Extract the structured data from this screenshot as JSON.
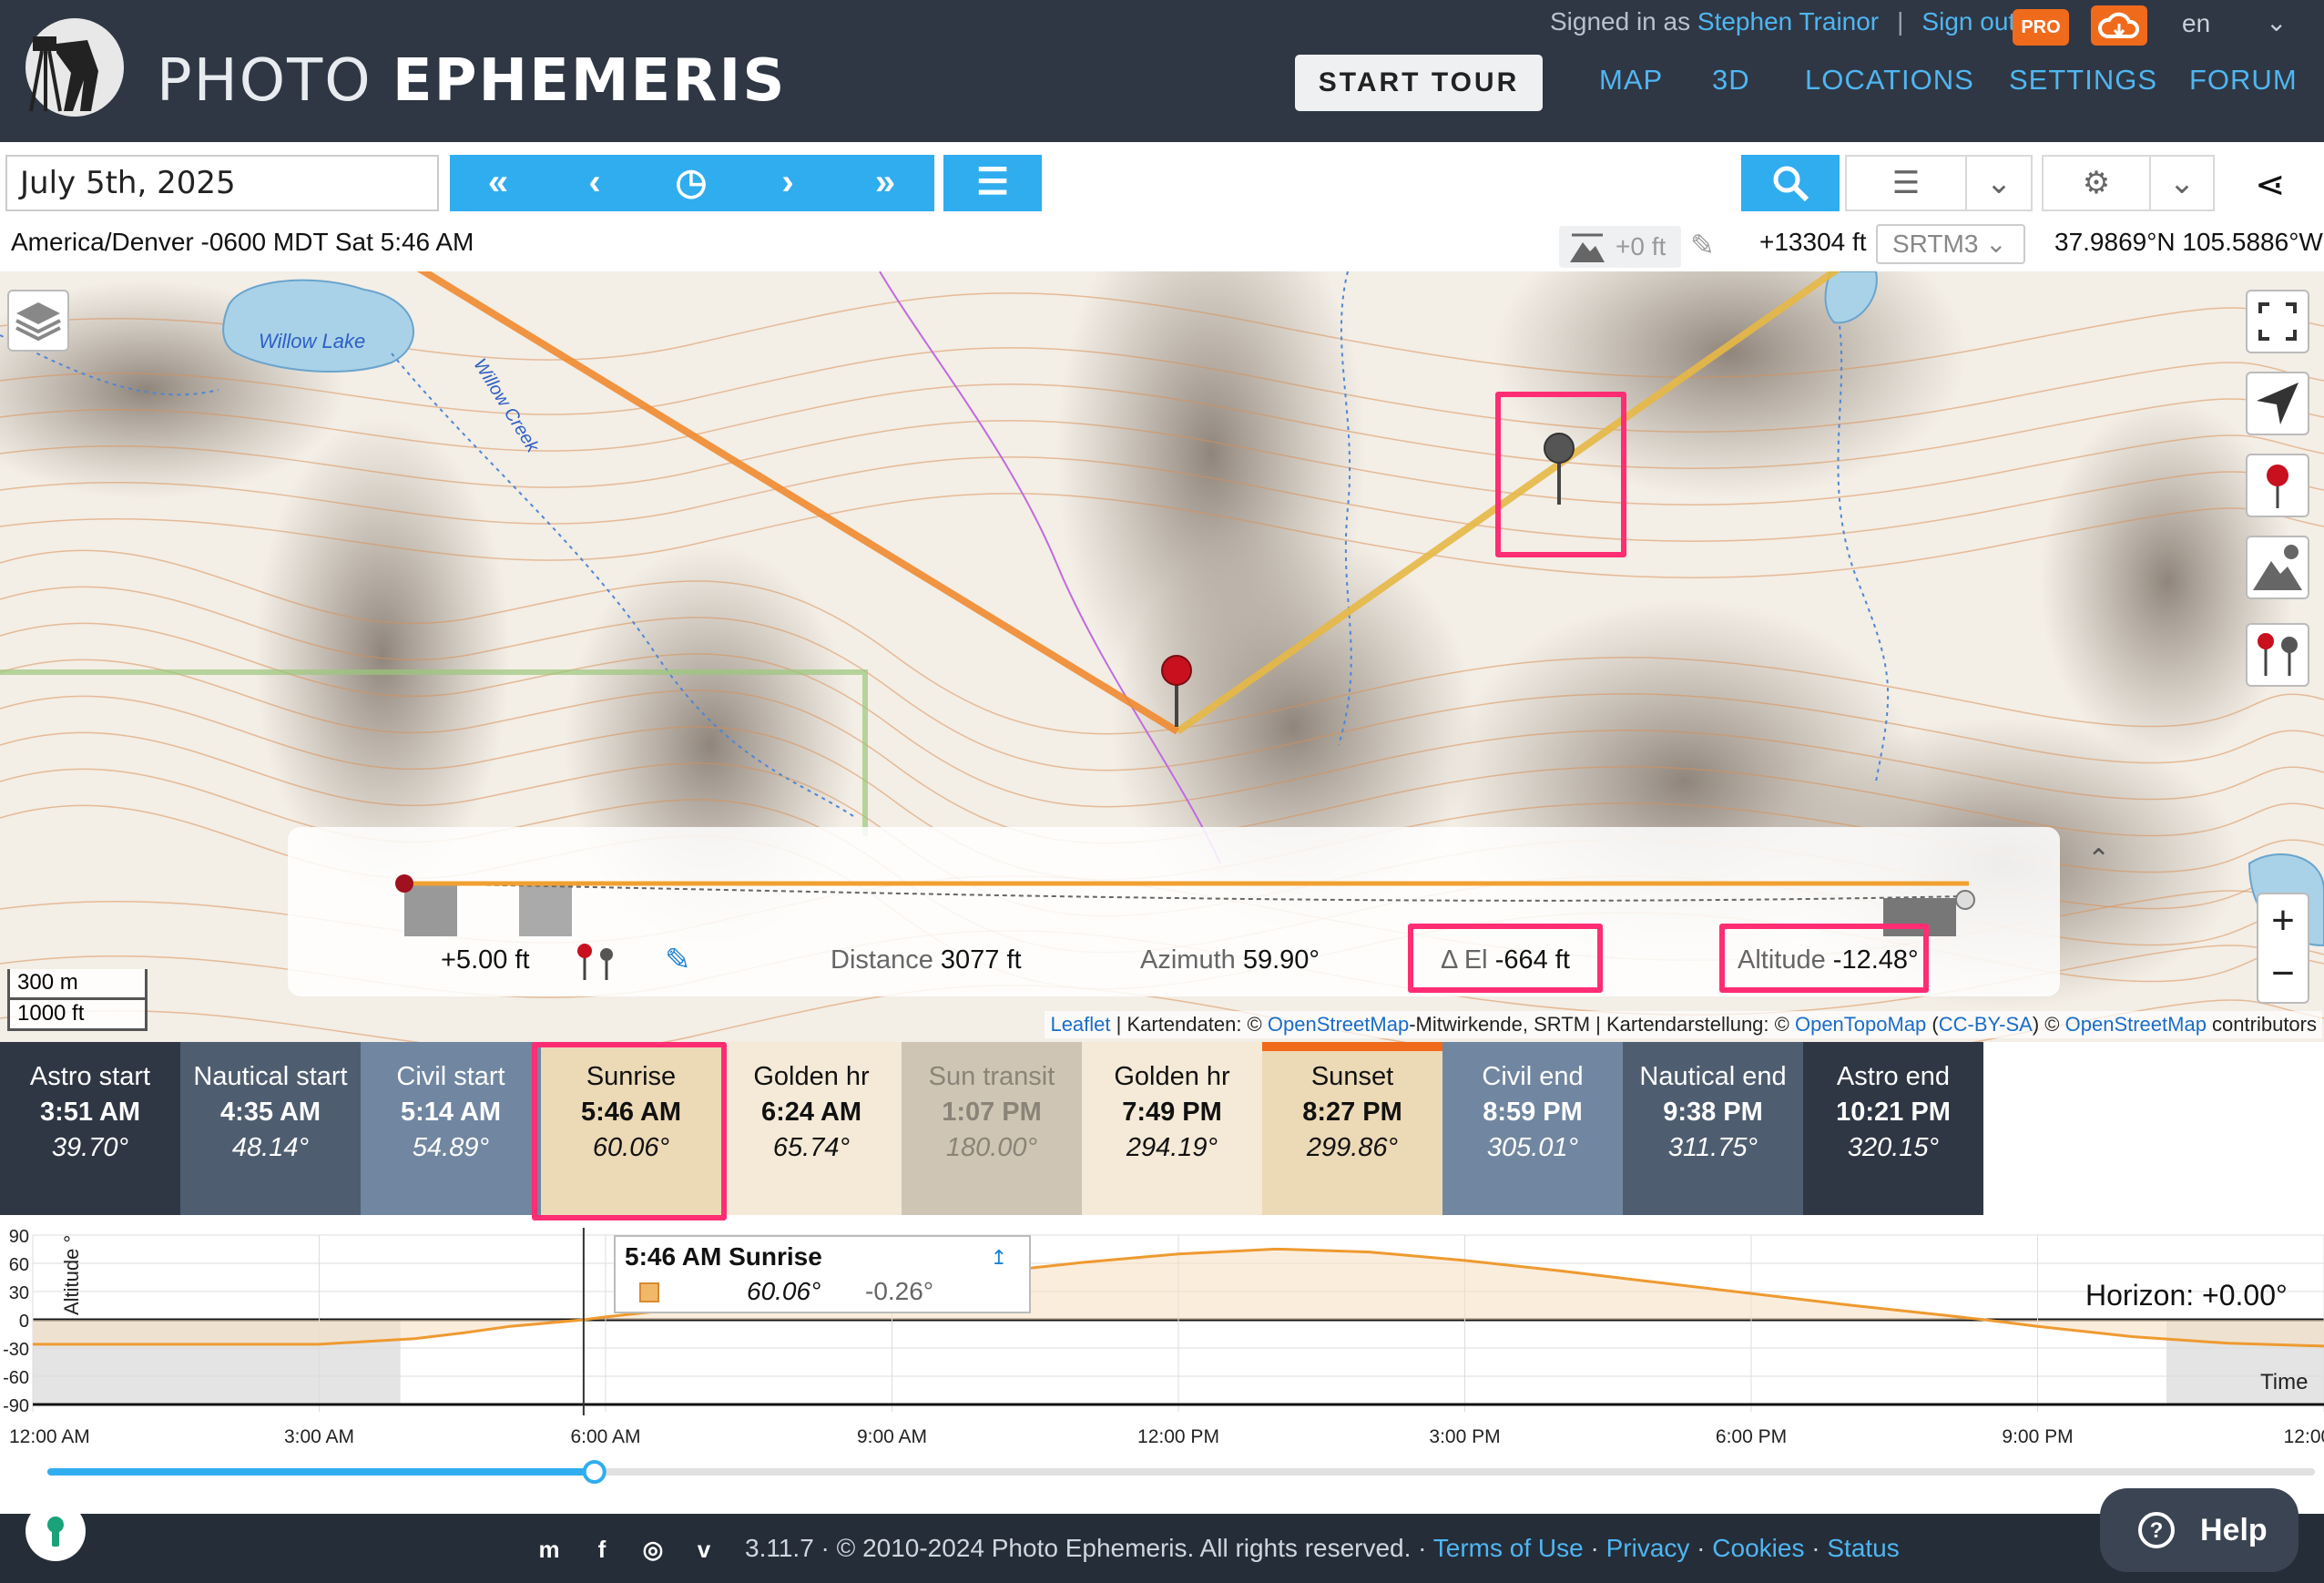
{
  "header": {
    "brand_light": "PHOTO",
    "brand_bold": "EPHEMERIS",
    "signed_in_prefix": "Signed in as",
    "user_name": "Stephen Trainor",
    "sign_out": "Sign out",
    "pro_badge": "PRO",
    "language": "en",
    "start_tour": "START TOUR",
    "nav": [
      "MAP",
      "3D",
      "LOCATIONS",
      "SETTINGS",
      "FORUM"
    ],
    "accent_color": "#4fb6f2",
    "pro_color": "#f06a1c"
  },
  "toolbar": {
    "date_value": "July 5th, 2025",
    "timezone_line": "America/Denver -0600 MDT Sat 5:46 AM",
    "elevation_offset": "+0 ft",
    "elevation": "+13304 ft",
    "dem_source": "SRTM3",
    "coordinates": "37.9869°N 105.5886°W",
    "time_buttons": [
      "fast-back-icon",
      "step-back-icon",
      "now-clock-icon",
      "step-forward-icon",
      "fast-forward-icon"
    ],
    "list_icon": "list-icon",
    "search_icon": "search-icon",
    "settings_icon": "gear-icon",
    "share_icon": "share-icon"
  },
  "map": {
    "lake_label": "Willow Lake",
    "creek_label": "Willow Creek",
    "scale_metric": "300 m",
    "scale_imperial": "1000 ft",
    "attribution": {
      "leaflet": "Leaflet",
      "text1": " | Kartendaten: © ",
      "osm": "OpenStreetMap",
      "text2": "-Mitwirkende, SRTM | Kartendarstellung: © ",
      "otm": "OpenTopoMap",
      "license": "CC-BY-SA",
      "text3": ") © ",
      "osm2": "OpenStreetMap",
      "text4": " contributors"
    },
    "sunrise_line_color": "#f08a30",
    "sunset_line_color": "#e6b845"
  },
  "profile": {
    "height_offset": "+5.00 ft",
    "distance_label": "Distance",
    "distance_value": "3077 ft",
    "azimuth_label": "Azimuth",
    "azimuth_value": "59.90°",
    "delta_el_label": "Δ El",
    "delta_el_value": "-664 ft",
    "altitude_label": "Altitude",
    "altitude_value": "-12.48°"
  },
  "events": [
    {
      "name": "Astro start",
      "time": "3:51 AM",
      "azimuth": "39.70°",
      "bg": "#2f3744",
      "fg": "#ffffff"
    },
    {
      "name": "Nautical start",
      "time": "4:35 AM",
      "azimuth": "48.14°",
      "bg": "#4f5d70",
      "fg": "#ffffff"
    },
    {
      "name": "Civil start",
      "time": "5:14 AM",
      "azimuth": "54.89°",
      "bg": "#7186a0",
      "fg": "#ffffff"
    },
    {
      "name": "Sunrise",
      "time": "5:46 AM",
      "azimuth": "60.06°",
      "bg": "#ecd9b6",
      "fg": "#111111"
    },
    {
      "name": "Golden hr",
      "time": "6:24 AM",
      "azimuth": "65.74°",
      "bg": "#f4ead7",
      "fg": "#111111"
    },
    {
      "name": "Sun transit",
      "time": "1:07 PM",
      "azimuth": "180.00°",
      "bg": "#cfc5b4",
      "fg": "#8a8478"
    },
    {
      "name": "Golden hr",
      "time": "7:49 PM",
      "azimuth": "294.19°",
      "bg": "#f4ead7",
      "fg": "#111111"
    },
    {
      "name": "Sunset",
      "time": "8:27 PM",
      "azimuth": "299.86°",
      "bg": "#ecd9b6",
      "fg": "#111111"
    },
    {
      "name": "Civil end",
      "time": "8:59 PM",
      "azimuth": "305.01°",
      "bg": "#7186a0",
      "fg": "#ffffff"
    },
    {
      "name": "Nautical end",
      "time": "9:38 PM",
      "azimuth": "311.75°",
      "bg": "#4f5d70",
      "fg": "#ffffff"
    },
    {
      "name": "Astro end",
      "time": "10:21 PM",
      "azimuth": "320.15°",
      "bg": "#2f3744",
      "fg": "#ffffff"
    }
  ],
  "chart_data": {
    "type": "area",
    "ylabel": "Altitude °",
    "xlabel": "Time",
    "y_ticks": [
      90,
      60,
      30,
      0,
      -30,
      -60,
      -90
    ],
    "ylim": [
      -90,
      90
    ],
    "x_ticks": [
      "12:00 AM",
      "3:00 AM",
      "6:00 AM",
      "9:00 AM",
      "12:00 PM",
      "3:00 PM",
      "6:00 PM",
      "9:00 PM",
      "12:00 AM"
    ],
    "horizon_label": "Horizon: +0.00°",
    "series": [
      {
        "values_hours": [
          0,
          1,
          2,
          3,
          4,
          4.5,
          5,
          5.77,
          6,
          7,
          8,
          9,
          10,
          11,
          12,
          13,
          13.1,
          14,
          15,
          16,
          17,
          18,
          19,
          20,
          20.45,
          21,
          22,
          23,
          24
        ],
        "values_altitude": [
          -26,
          -26,
          -26,
          -26,
          -20,
          -14,
          -7,
          0,
          3,
          14,
          26,
          38,
          50,
          61,
          70,
          75,
          75,
          72,
          63,
          52,
          40,
          28,
          16,
          5,
          0,
          -7,
          -18,
          -25,
          -28
        ]
      }
    ],
    "cursor_time": "5:46 AM",
    "tooltip": {
      "title": "5:46 AM Sunrise",
      "azimuth": "60.06°",
      "altitude": "-0.26°"
    },
    "slider_position_hours": 5.77
  },
  "footer": {
    "version_text": "3.11.7 · © 2010-2024 Photo Ephemeris. All rights reserved. · ",
    "terms": "Terms of Use",
    "privacy": "Privacy",
    "cookies": "Cookies",
    "status": "Status",
    "sep": " · ",
    "help": "Help"
  }
}
